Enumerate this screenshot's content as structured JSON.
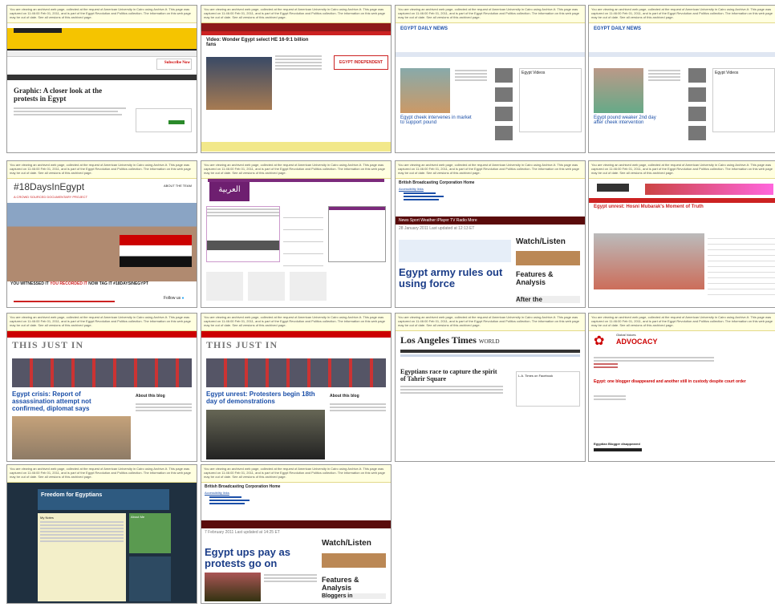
{
  "archive_notice": "You are viewing an archived web page, collected at the request of American University in Cairo using Archive-It. This page was captured on 11:46:00 Feb 01, 2011, and is part of the Egypt Revolution and Politics collection. The information on this web page may be out of date. See all versions of this archived page.",
  "thumbs": {
    "t1": {
      "headline": "Graphic: A closer look at the protests in Egypt",
      "subscribe": "Subscribe Now"
    },
    "t2": {
      "headline": "Video: Wonder Egypt select HE 16-9:1 billion fans",
      "logo": "EGYPT INDEPENDENT"
    },
    "t3": {
      "logo": "EGYPT DAILY NEWS",
      "headline": "Egypt cheek intervenes in market to support pound",
      "side_title": "Egypt Videos"
    },
    "t4": {
      "logo": "EGYPT DAILY NEWS",
      "headline": "Egypt pound weaker 2nd day after cheek intervention",
      "side_title": "Egypt Videos"
    },
    "t5": {
      "hashtag": "#18DaysInEgypt",
      "subtitle": "A CROWD SOURCED DOCUMENTARY PROJECT",
      "slogan_a": "YOU WITNESSED IT",
      "slogan_b": "YOU RECORDED IT",
      "slogan_c": "NOW TAG IT #18DAYSINEGYPT",
      "follow": "Follow us",
      "about": "ABOUT",
      "the_team": "THE TEAM",
      "contact": "CONTACT"
    },
    "t6": {
      "logo": "العربية"
    },
    "t7": {
      "org": "British Broadcasting Corporation  Home",
      "accessibility": "Accessibility links",
      "nav": "News  Sport  Weather  iPlayer  TV  Radio  More",
      "date": "28 January 2011 Last updated at 12:13 ET",
      "watch": "Watch/Listen",
      "headline": "Egypt army rules out using force",
      "features": "Features & Analysis",
      "after": "After the"
    },
    "t8": {
      "title": "Egypt unrest: Hosni Mubarak's Moment of Truth"
    },
    "t9": {
      "brand": "THIS JUST IN",
      "headline": "Egypt crisis: Report of assassination attempt not confirmed, diplomat says",
      "about": "About this blog"
    },
    "t10": {
      "brand": "THIS JUST IN",
      "headline": "Egypt unrest: Protesters begin 18th day of demonstrations",
      "about": "About this blog"
    },
    "t11": {
      "masthead": "Los Angeles Times",
      "section": "WORLD",
      "headline": "Egyptians race to capture the spirit of Tahrir Square",
      "box_title": "L.A. Times on Facebook"
    },
    "t12": {
      "org": "Global Voices",
      "brand": "ADVOCACY",
      "headline": "Egypt: one blogger disappeared and another still in custody despite court order",
      "sub": "Egyptian Blogger disappeared"
    },
    "t13": {
      "title": "Freedom for Egyptians",
      "side": "About Me",
      "blog": "My Notes"
    },
    "t14": {
      "org": "British Broadcasting Corporation  Home",
      "accessibility": "Accessibility links",
      "date": "7 February 2011 Last updated at 14:25 ET",
      "watch": "Watch/Listen",
      "headline": "Egypt ups pay as protests go on",
      "features": "Features & Analysis",
      "sub": "Bloggers in"
    }
  }
}
